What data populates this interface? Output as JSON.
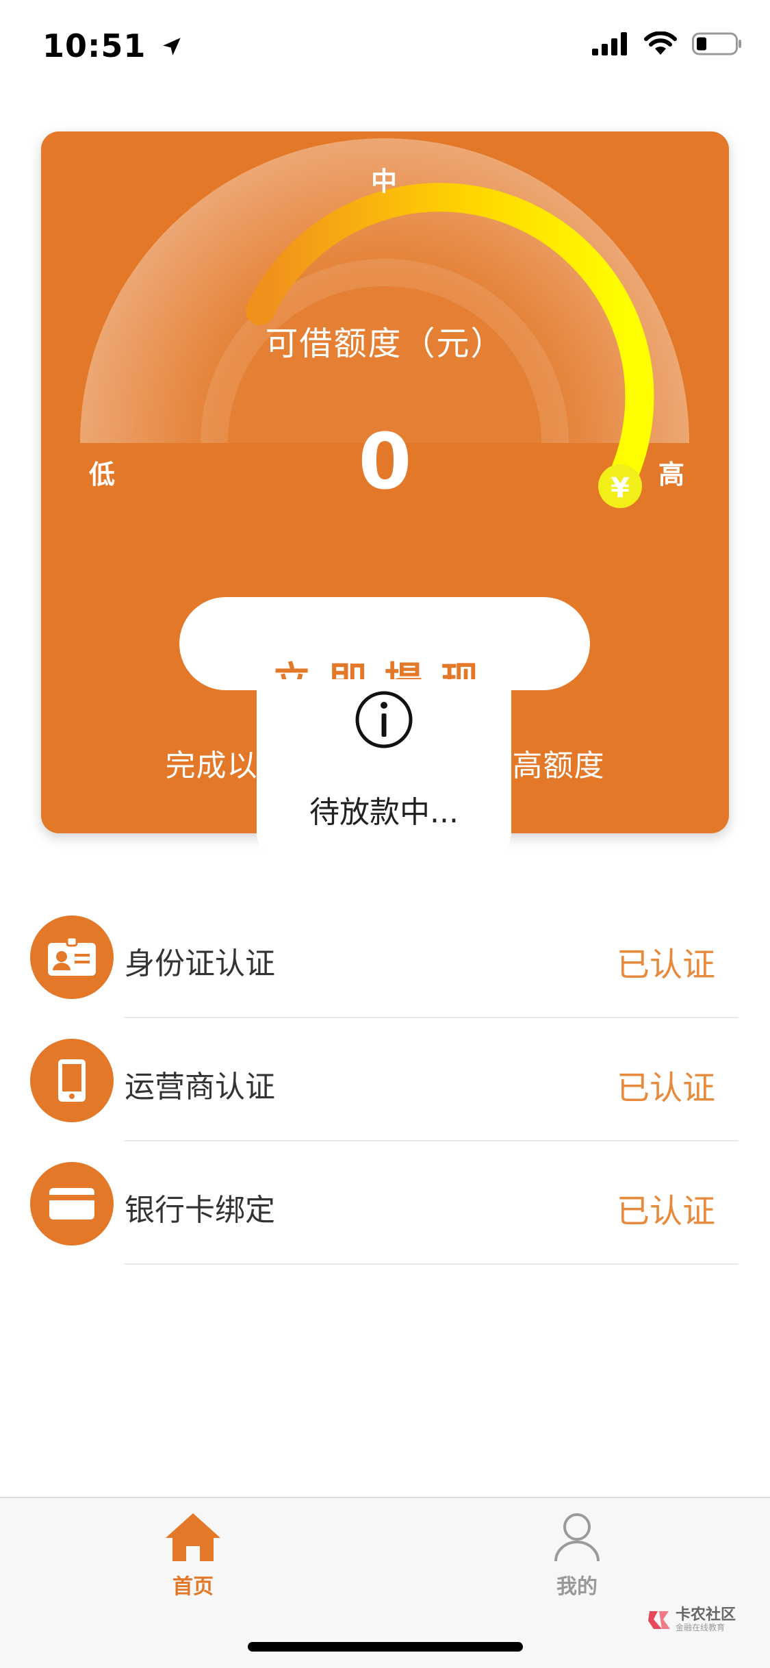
{
  "status_bar": {
    "time": "10:51"
  },
  "gauge": {
    "label_mid": "中",
    "label_low": "低",
    "label_high": "高",
    "marker_symbol": "¥"
  },
  "credit": {
    "title": "可借额度（元）",
    "value": "0"
  },
  "withdraw_button": {
    "label": "立即提现"
  },
  "hint": {
    "left": "完成以",
    "right": "高额度"
  },
  "popup": {
    "text": "待放款中..."
  },
  "auth_items": [
    {
      "label": "身份证认证",
      "status": "已认证",
      "icon": "id-card-icon"
    },
    {
      "label": "运营商认证",
      "status": "已认证",
      "icon": "phone-icon"
    },
    {
      "label": "银行卡绑定",
      "status": "已认证",
      "icon": "bank-card-icon"
    }
  ],
  "tab_bar": {
    "home_label": "首页",
    "mine_label": "我的"
  },
  "watermark": {
    "title": "卡农社区",
    "subtitle": "金融在线教育"
  },
  "colors": {
    "accent": "#e37828",
    "status_text": "#e68b3d"
  }
}
